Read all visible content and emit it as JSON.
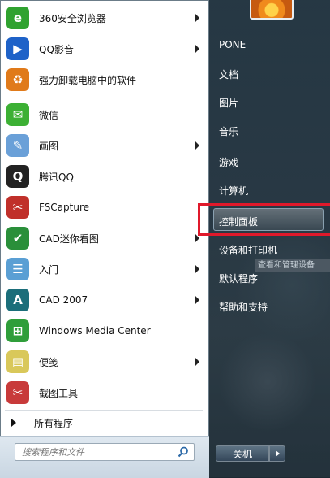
{
  "programs": [
    {
      "label": "360安全浏览器",
      "icon": "ie-360-browser-icon",
      "color": "#2fa22f",
      "glyph": "e",
      "arrow": true
    },
    {
      "label": "QQ影音",
      "icon": "qq-player-icon",
      "color": "#1e62c8",
      "glyph": "▶",
      "arrow": true
    },
    {
      "label": "强力卸载电脑中的软件",
      "icon": "uninstall-box-icon",
      "color": "#e07a1a",
      "glyph": "♻",
      "arrow": false
    },
    {
      "label": "微信",
      "icon": "wechat-icon",
      "color": "#3cb034",
      "glyph": "✉",
      "arrow": false
    },
    {
      "label": "画图",
      "icon": "paint-palette-icon",
      "color": "#6aa0d8",
      "glyph": "✎",
      "arrow": true
    },
    {
      "label": "腾讯QQ",
      "icon": "qq-penguin-icon",
      "color": "#222222",
      "glyph": "Q",
      "arrow": false
    },
    {
      "label": "FSCapture",
      "icon": "fscapture-icon",
      "color": "#c0302a",
      "glyph": "✂",
      "arrow": false
    },
    {
      "label": "CAD迷你看图",
      "icon": "cad-viewer-icon",
      "color": "#2a8f3a",
      "glyph": "✔",
      "arrow": true
    },
    {
      "label": "入门",
      "icon": "getting-started-icon",
      "color": "#5a9fd4",
      "glyph": "☰",
      "arrow": true
    },
    {
      "label": "CAD 2007",
      "icon": "autocad-icon",
      "color": "#1b6e7a",
      "glyph": "A",
      "arrow": true
    },
    {
      "label": "Windows Media Center",
      "icon": "media-center-icon",
      "color": "#2f9e3a",
      "glyph": "⊞",
      "arrow": false
    },
    {
      "label": "便笺",
      "icon": "sticky-notes-icon",
      "color": "#d9c85a",
      "glyph": "▤",
      "arrow": true
    },
    {
      "label": "截图工具",
      "icon": "snipping-tool-icon",
      "color": "#c83a3a",
      "glyph": "✂",
      "arrow": false
    }
  ],
  "all_programs": "所有程序",
  "search": {
    "placeholder": "搜索程序和文件"
  },
  "right_items": [
    "PONE",
    "文档",
    "图片",
    "音乐",
    "游戏",
    "计算机",
    "控制面板",
    "设备和打印机",
    "默认程序",
    "帮助和支持"
  ],
  "tooltip": "查看和管理设备",
  "shutdown": "关机"
}
